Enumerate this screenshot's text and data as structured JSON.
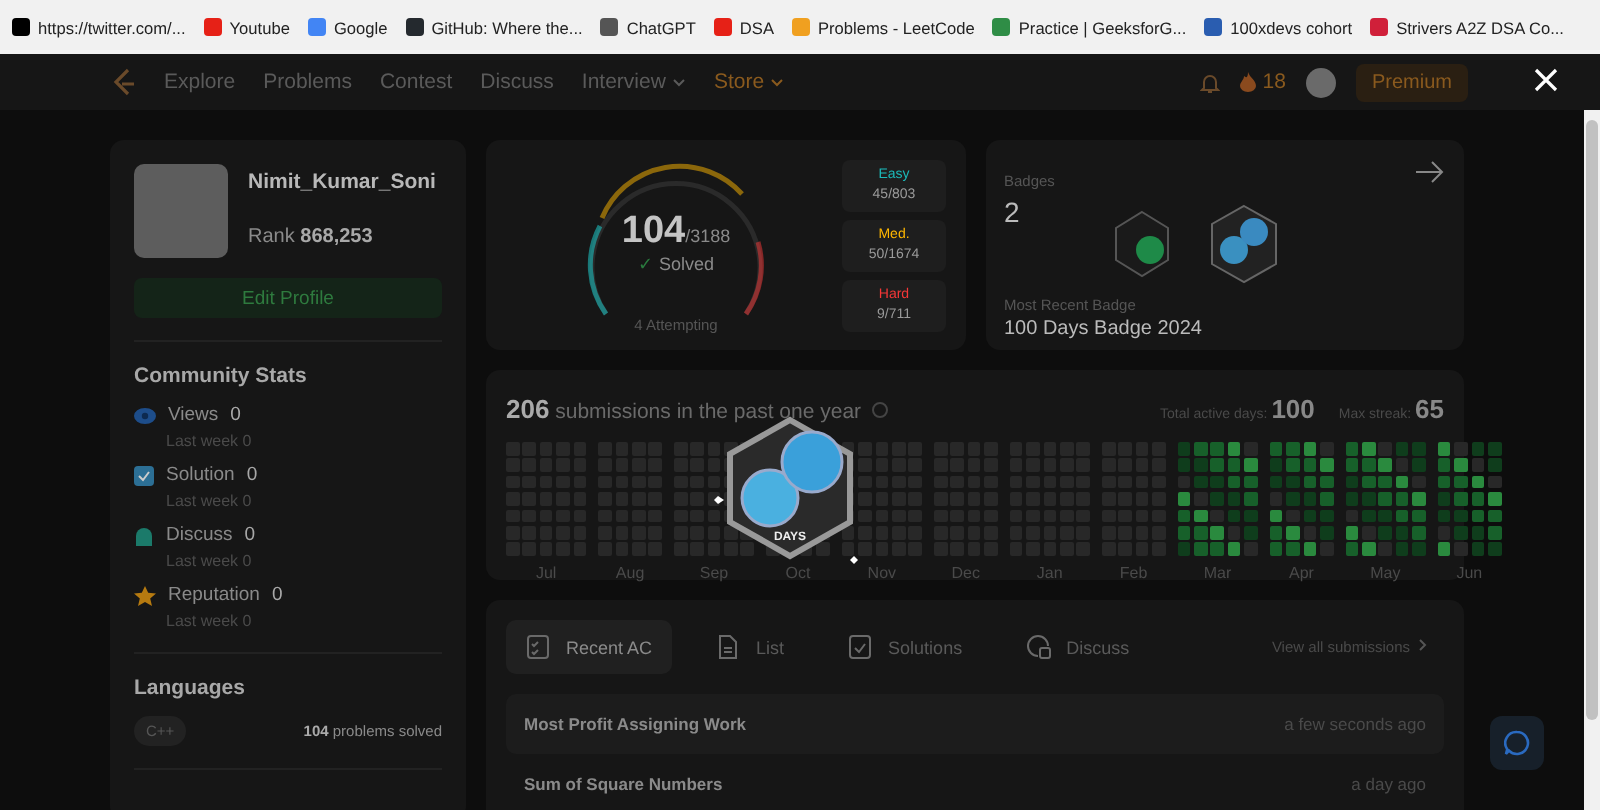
{
  "bookmarks": [
    {
      "label": "https://twitter.com/...",
      "color": "#000000"
    },
    {
      "label": "Youtube",
      "color": "#e62117"
    },
    {
      "label": "Google",
      "color": "#4285f4"
    },
    {
      "label": "GitHub: Where the...",
      "color": "#24292e"
    },
    {
      "label": "ChatGPT",
      "color": "#555555"
    },
    {
      "label": "DSA",
      "color": "#e62117"
    },
    {
      "label": "Problems - LeetCode",
      "color": "#f0a020"
    },
    {
      "label": "Practice | GeeksforG...",
      "color": "#2f8d46"
    },
    {
      "label": "100xdevs cohort",
      "color": "#2a5db0"
    },
    {
      "label": "Strivers A2Z DSA Co...",
      "color": "#d0203a"
    }
  ],
  "nav": {
    "items": [
      {
        "label": "Explore",
        "kind": "link"
      },
      {
        "label": "Problems",
        "kind": "link"
      },
      {
        "label": "Contest",
        "kind": "link"
      },
      {
        "label": "Discuss",
        "kind": "link"
      },
      {
        "label": "Interview",
        "kind": "menu"
      },
      {
        "label": "Store",
        "kind": "store"
      }
    ],
    "streak": "18",
    "premium": "Premium"
  },
  "profile": {
    "name": "Nimit_Kumar_Soni",
    "rank_label": "Rank",
    "rank": "868,253",
    "edit": "Edit Profile"
  },
  "community": {
    "title": "Community Stats",
    "items": [
      {
        "kind": "views",
        "label": "Views",
        "value": "0",
        "sub": "Last week",
        "sub_value": "0"
      },
      {
        "kind": "solution",
        "label": "Solution",
        "value": "0",
        "sub": "Last week",
        "sub_value": "0"
      },
      {
        "kind": "discuss",
        "label": "Discuss",
        "value": "0",
        "sub": "Last week",
        "sub_value": "0"
      },
      {
        "kind": "reputation",
        "label": "Reputation",
        "value": "0",
        "sub": "Last week",
        "sub_value": "0"
      }
    ]
  },
  "languages": {
    "title": "Languages",
    "items": [
      {
        "name": "C++",
        "count": "104",
        "suffix": "problems solved"
      }
    ]
  },
  "solved": {
    "count": "104",
    "total": "/3188",
    "check": "✓",
    "label": "Solved",
    "attempting": "4 Attempting",
    "levels": [
      {
        "label": "Easy",
        "value": "45/803",
        "color": "#1cbaba"
      },
      {
        "label": "Med.",
        "value": "50/1674",
        "color": "#ffb700"
      },
      {
        "label": "Hard",
        "value": "9/711",
        "color": "#f63737"
      }
    ]
  },
  "badges": {
    "title": "Badges",
    "count": "2",
    "recent_label": "Most Recent Badge",
    "recent": "100 Days Badge 2024"
  },
  "calendar": {
    "count": "206",
    "text": "submissions in the past one year",
    "active_label": "Total active days:",
    "active": "100",
    "streak_label": "Max streak:",
    "streak": "65",
    "months": [
      "Jul",
      "Aug",
      "Sep",
      "Oct",
      "Nov",
      "Dec",
      "Jan",
      "Feb",
      "Mar",
      "Apr",
      "May",
      "Jun"
    ]
  },
  "popup_badge": {
    "caption": "DAYS"
  },
  "recent": {
    "tabs": [
      {
        "label": "Recent AC",
        "kind": "recent",
        "selected": true
      },
      {
        "label": "List",
        "kind": "list",
        "selected": false
      },
      {
        "label": "Solutions",
        "kind": "solutions",
        "selected": false
      },
      {
        "label": "Discuss",
        "kind": "discuss",
        "selected": false
      }
    ],
    "view_all": "View all submissions",
    "rows": [
      {
        "title": "Most Profit Assigning Work",
        "time": "a few seconds ago"
      },
      {
        "title": "Sum of Square Numbers",
        "time": "a day ago"
      }
    ]
  }
}
